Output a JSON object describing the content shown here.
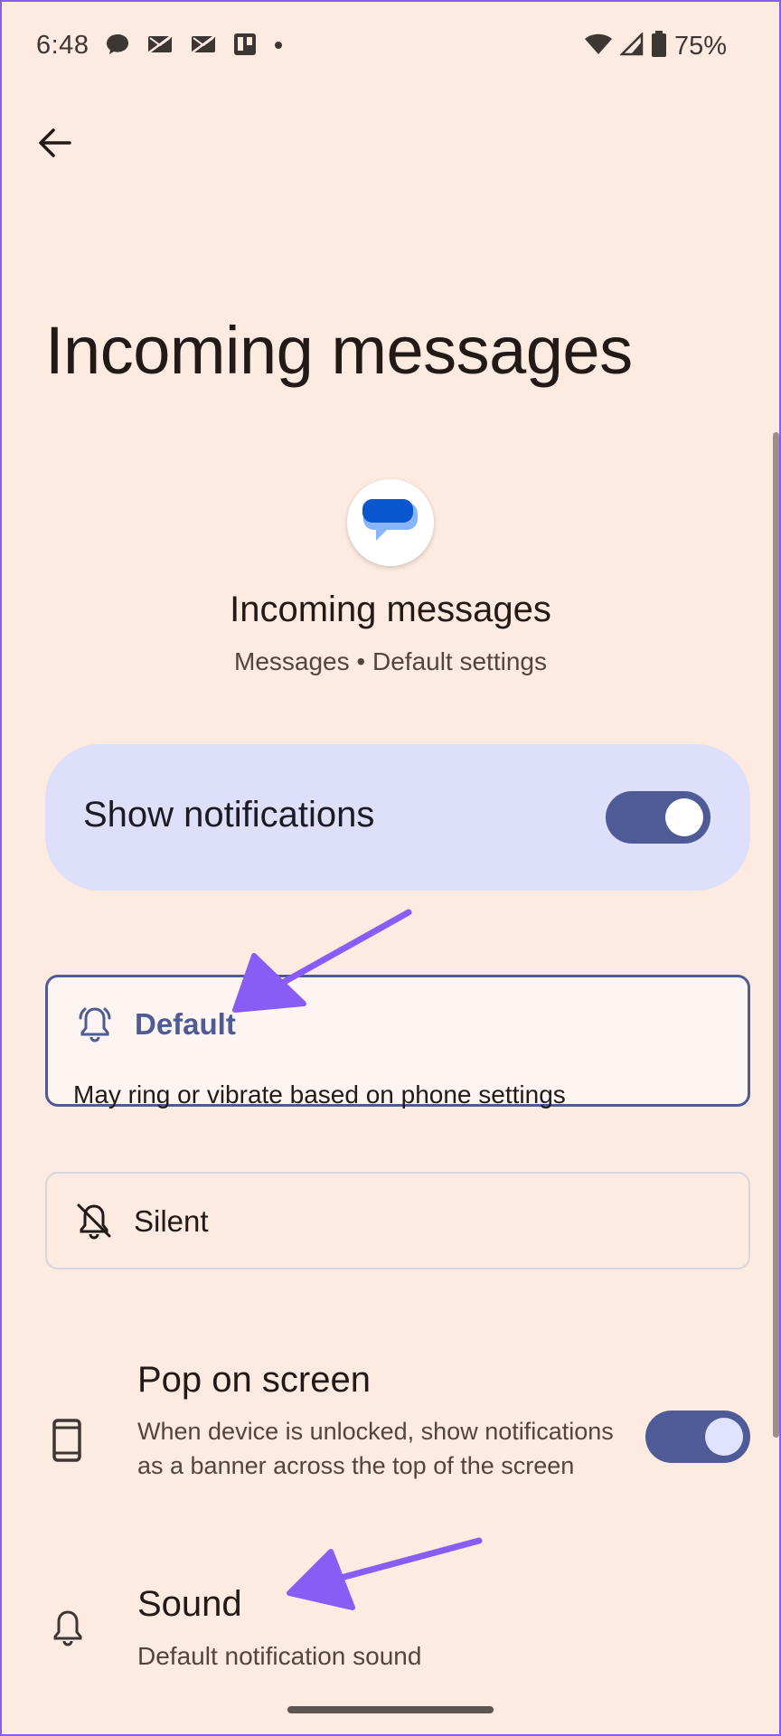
{
  "status_bar": {
    "time": "6:48",
    "battery_percent": "75%",
    "notification_icons": [
      "chat-bubble-icon",
      "mail-off-icon",
      "mail-off-icon",
      "trello-icon",
      "dot-icon"
    ],
    "system_icons": [
      "wifi-icon",
      "cell-signal-icon",
      "battery-icon"
    ]
  },
  "header": {
    "back_icon": "arrow-left-icon",
    "title": "Incoming messages"
  },
  "channel": {
    "app_icon": "messages-app-icon",
    "name": "Incoming messages",
    "subtitle": "Messages • Default settings"
  },
  "show_notifications": {
    "label": "Show notifications",
    "enabled": true
  },
  "alert_options": [
    {
      "icon": "bell-ring-icon",
      "label": "Default",
      "description": "May ring or vibrate based on phone settings",
      "selected": true
    },
    {
      "icon": "bell-off-icon",
      "label": "Silent",
      "selected": false
    }
  ],
  "settings": {
    "pop_on_screen": {
      "icon": "phone-device-icon",
      "title": "Pop on screen",
      "description": "When device is unlocked, show notifications as a banner across the top of the screen",
      "enabled": true
    },
    "sound": {
      "icon": "bell-icon",
      "title": "Sound",
      "description": "Default notification sound"
    }
  },
  "colors": {
    "background": "#fdebe2",
    "accent": "#4e5b97",
    "card_highlight": "#dedffa",
    "annotation_arrow": "#8a5cf6"
  }
}
